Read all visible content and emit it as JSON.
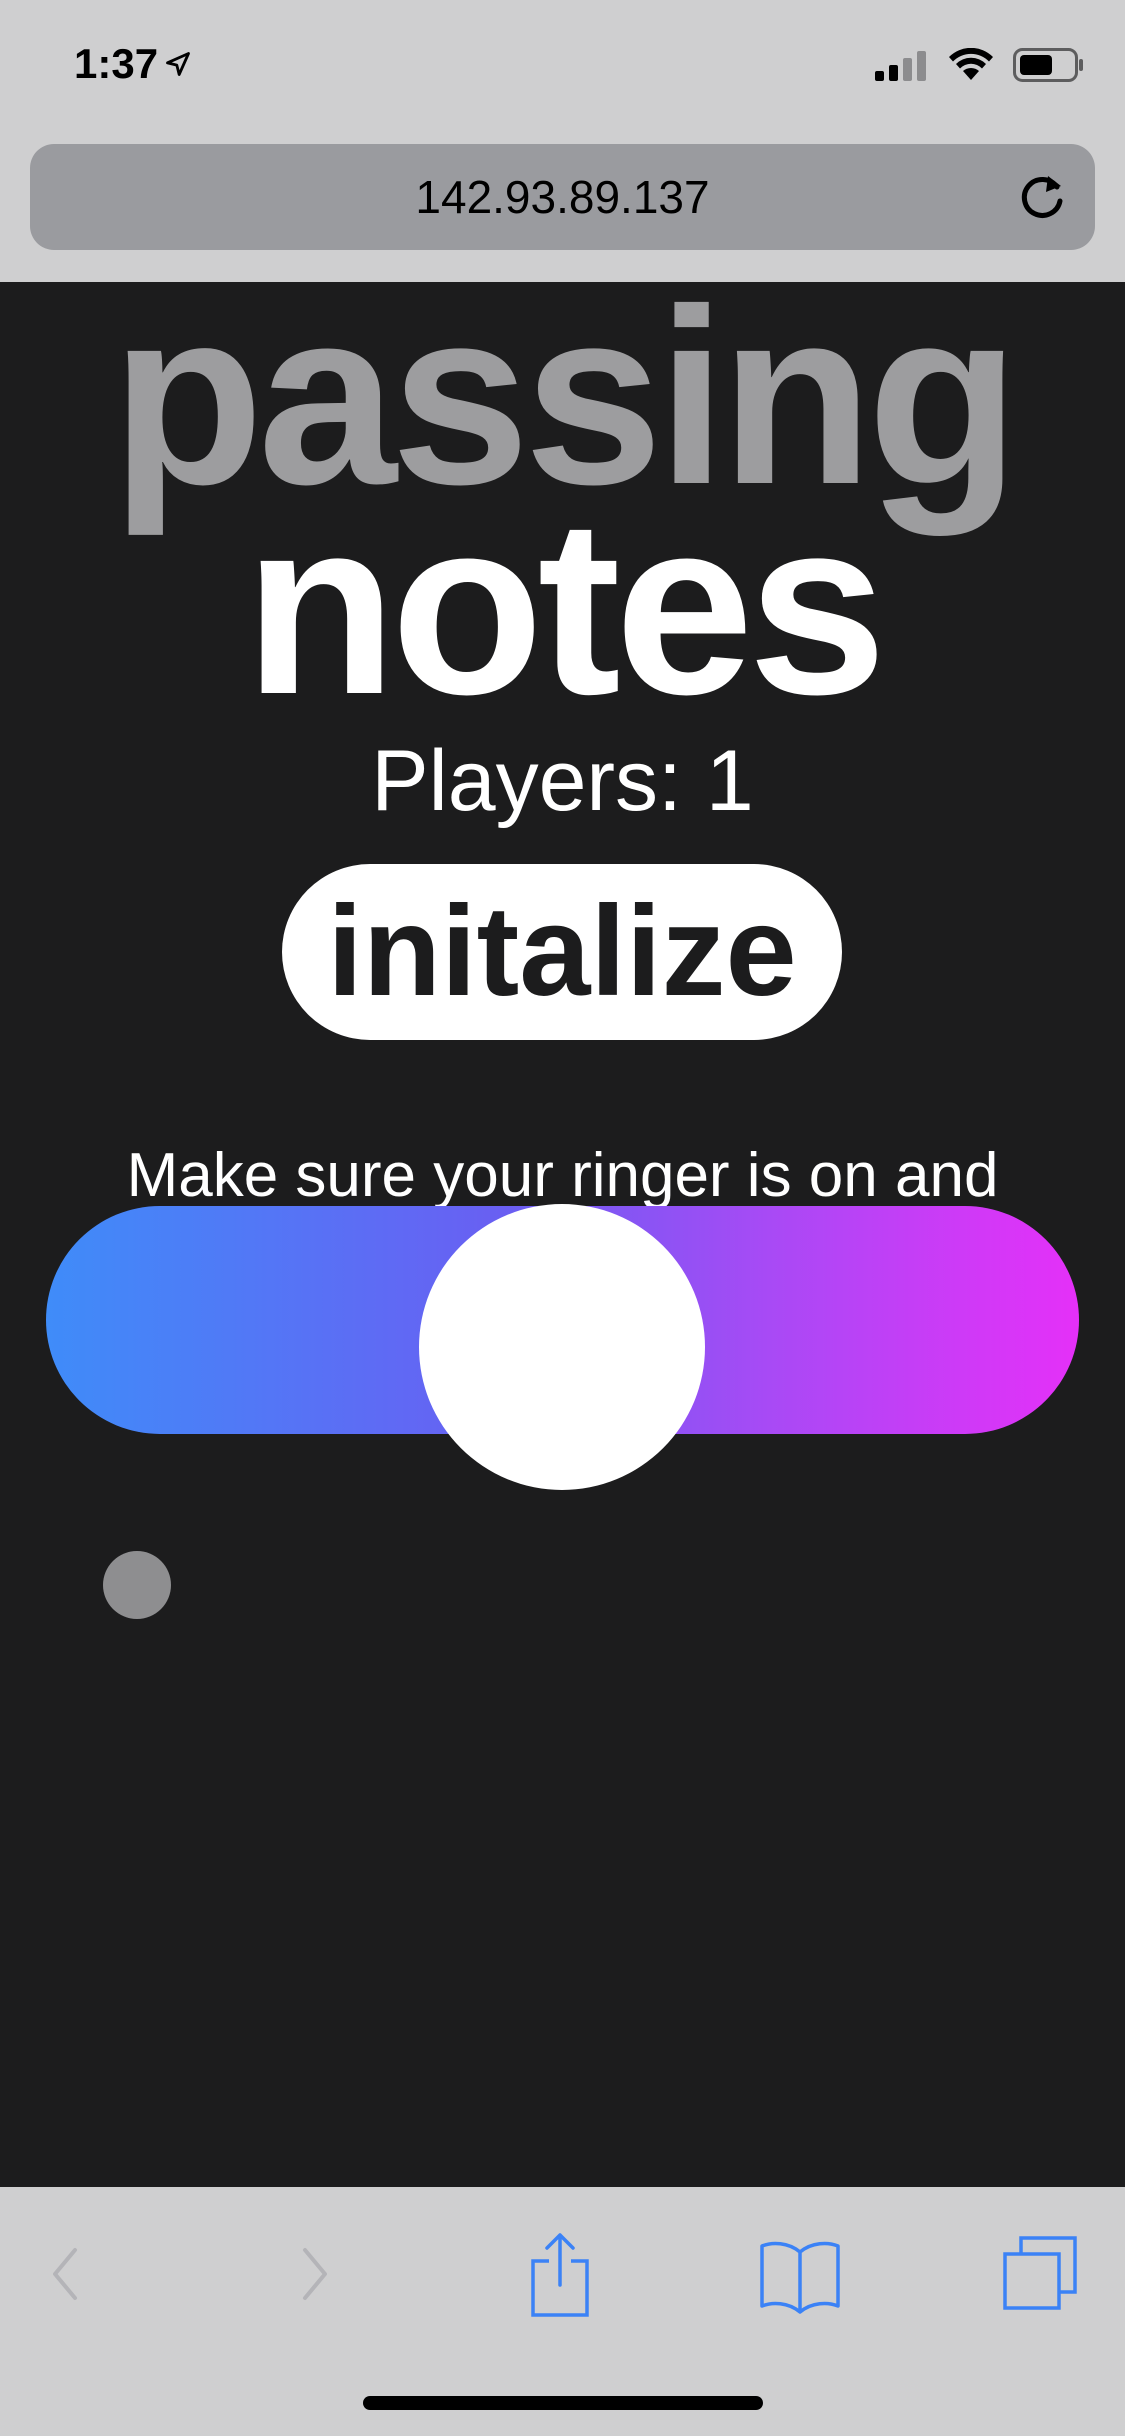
{
  "status_bar": {
    "time": "1:37"
  },
  "browser": {
    "url": "142.93.89.137"
  },
  "page": {
    "title_line1": "passing",
    "title_line2": "notes",
    "players": "Players: 1",
    "initialize_label": "initalize",
    "instructions": "Make sure your ringer is on and you've pressed \"initialize,\" then begin playing!"
  },
  "slider": {
    "value_fraction": 0.5
  },
  "colors": {
    "background": "#1c1c1d",
    "title_gray": "#9d9d9f",
    "gradient_start": "#3f8cf9",
    "gradient_end": "#e530f8",
    "toolbar_accent": "#3b82f6"
  },
  "toolbar": {
    "icons": [
      "back-icon",
      "forward-icon",
      "share-icon",
      "bookmarks-icon",
      "tabs-icon"
    ]
  }
}
